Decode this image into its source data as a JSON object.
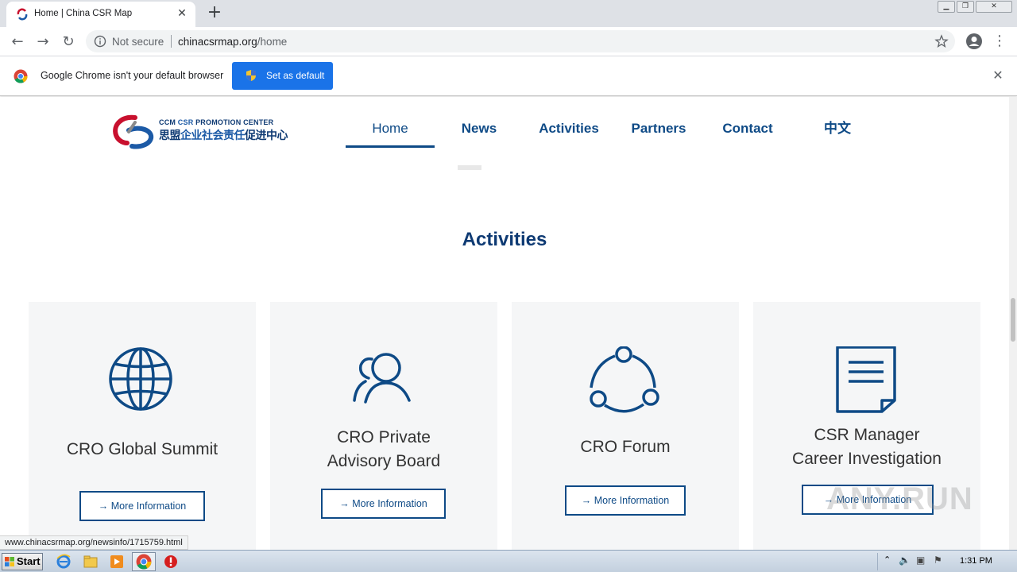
{
  "browser": {
    "tab_title": "Home | China CSR Map",
    "address_not_secure": "Not secure",
    "address_domain": "chinacsrmap.org",
    "address_path": "/home",
    "infobar_text": "Google Chrome isn't your default browser",
    "infobar_button": "Set as default",
    "status_url": "www.chinacsrmap.org/newsinfo/1715759.html"
  },
  "site": {
    "logo_en_prefix": "CCM ",
    "logo_en_csr": "CSR",
    "logo_en_suffix": " PROMOTION CENTER",
    "logo_cn_prefix": "思盟",
    "logo_cn_blue": "企业社会责任",
    "logo_cn_suffix": "促进中心",
    "nav": [
      {
        "label": "Home",
        "active": true
      },
      {
        "label": "News"
      },
      {
        "label": "Activities"
      },
      {
        "label": "Partners"
      },
      {
        "label": "Contact"
      },
      {
        "label": "中文"
      }
    ],
    "section_title": "Activities",
    "cards": [
      {
        "title_line1": "CRO Global Summit",
        "title_line2": "",
        "icon": "globe-icon",
        "button": "→ More Information"
      },
      {
        "title_line1": "CRO Private",
        "title_line2": "Advisory Board",
        "icon": "people-icon",
        "button": "→ More Information"
      },
      {
        "title_line1": "CRO Forum",
        "title_line2": "",
        "icon": "network-icon",
        "button": "→ More Information"
      },
      {
        "title_line1": "CSR Manager",
        "title_line2": "Career Investigation",
        "icon": "document-icon",
        "button": "→ More Information"
      }
    ]
  },
  "taskbar": {
    "start_label": "Start",
    "clock": "1:31 PM"
  },
  "watermark": "ANY.RUN",
  "colors": {
    "brand_blue": "#0e4a86",
    "chrome_blue": "#1a73e8",
    "card_bg": "#f5f6f7"
  }
}
